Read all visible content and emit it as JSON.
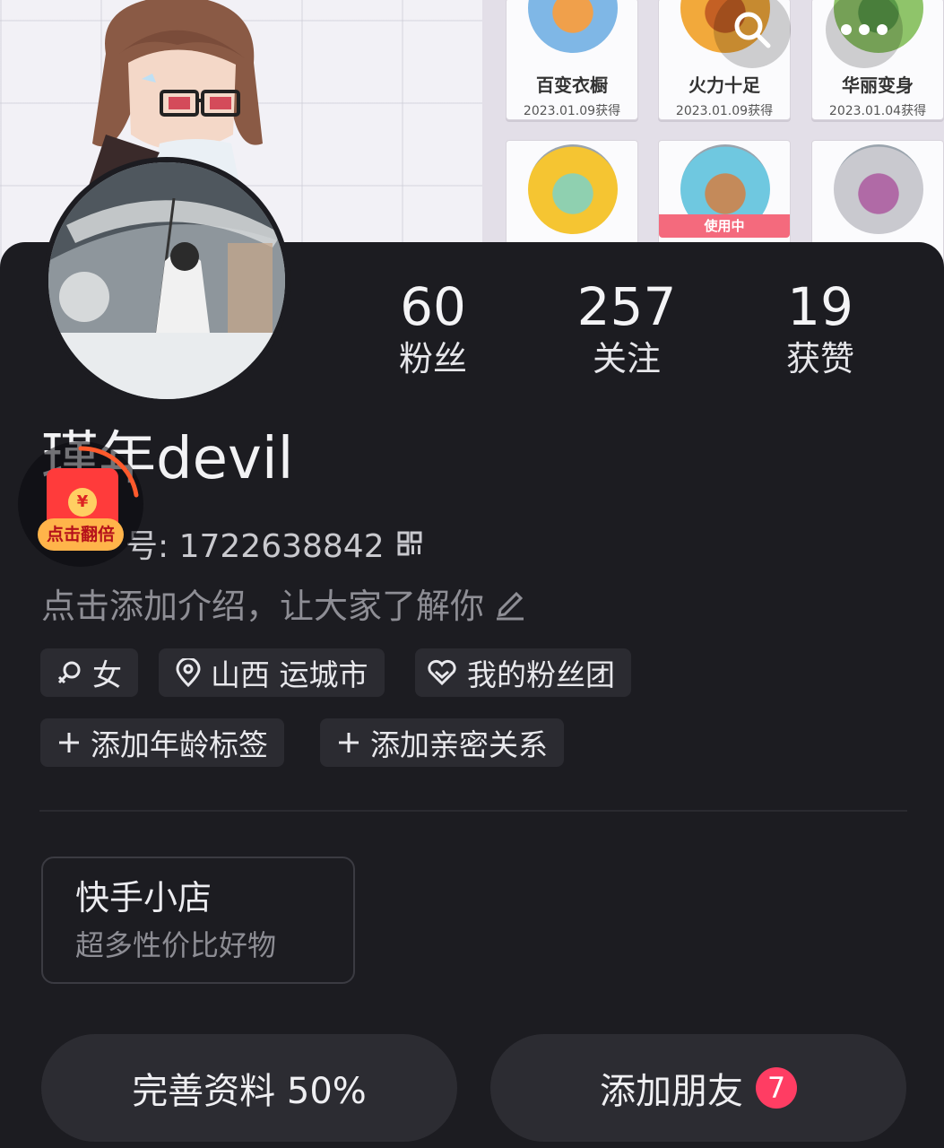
{
  "header": {
    "badges": [
      {
        "name": "百变衣橱",
        "date": "2023.01.09获得",
        "colors": [
          "#7fb7e6",
          "#f0a04b"
        ]
      },
      {
        "name": "火力十足",
        "date": "2023.01.09获得",
        "colors": [
          "#f2a93b",
          "#c46024"
        ]
      },
      {
        "name": "华丽变身",
        "date": "2023.01.04获得",
        "colors": [
          "#8fc46a",
          "#5a9a48"
        ]
      },
      {
        "name": "",
        "date": "",
        "colors": [
          "#f5c532",
          "#8fd0b0"
        ]
      },
      {
        "name": "",
        "date": "",
        "using": "使用中",
        "colors": [
          "#6fc8e0",
          "#c48a5a"
        ]
      },
      {
        "name": "",
        "date": "",
        "colors": [
          "#c9c9cf",
          "#b06aa6"
        ]
      }
    ],
    "search_icon": "search-icon",
    "more_icon": "more-icon"
  },
  "profile": {
    "stats": [
      {
        "value": "60",
        "label": "粉丝"
      },
      {
        "value": "257",
        "label": "关注"
      },
      {
        "value": "19",
        "label": "获赞"
      }
    ],
    "username": "瑾年devil",
    "id_text": "号: 1722638842",
    "bio": "点击添加介绍，让大家了解你"
  },
  "tags": {
    "gender": "女",
    "location": "山西 运城市",
    "fan_group": "我的粉丝团",
    "add_age": "添加年龄标签",
    "add_relation": "添加亲密关系"
  },
  "shop": {
    "title": "快手小店",
    "subtitle": "超多性价比好物"
  },
  "actions": {
    "complete_profile": "完善资料 50%",
    "add_friends": "添加朋友",
    "friend_count": "7"
  },
  "redpack": {
    "label": "点击翻倍",
    "symbol": "¥"
  },
  "colors": {
    "background": "#1c1c21",
    "tag_bg": "#2b2b31",
    "badge_red": "#ff3d63",
    "redpack_red": "#ff3b3b"
  }
}
